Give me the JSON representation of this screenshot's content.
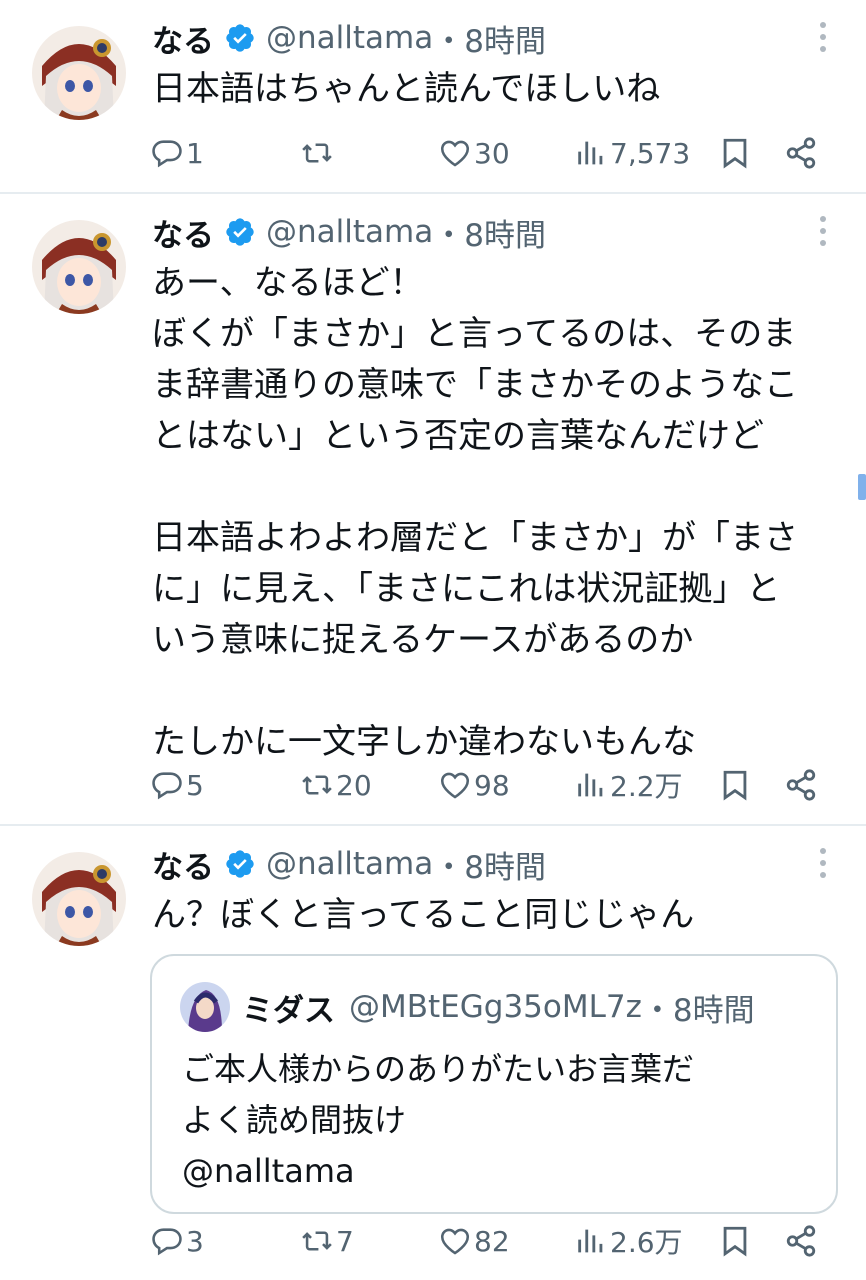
{
  "tweets": [
    {
      "name": "なる",
      "handle": "@nalltama",
      "time": "・8時間",
      "text": "日本語はちゃんと読んでほしいね",
      "replies": "1",
      "retweets": "",
      "likes": "30",
      "views": "7,573"
    },
    {
      "name": "なる",
      "handle": "@nalltama",
      "time": "・8時間",
      "text": "あー、なるほど！\nぼくが「まさか」と言ってるのは、そのま\nま辞書通りの意味で「まさかそのようなこ\nとはない」という否定の言葉なんだけど\n\n日本語よわよわ層だと「まさか」が「まさ\nに」に見え、「まさにこれは状況証拠」と\nいう意味に捉えるケースがあるのか\n\nたしかに一文字しか違わないもんな",
      "replies": "5",
      "retweets": "20",
      "likes": "98",
      "views": "2.2万"
    },
    {
      "name": "なる",
      "handle": "@nalltama",
      "time": "・8時間",
      "text": "ん？ぼくと言ってること同じじゃん",
      "replies": "3",
      "retweets": "7",
      "likes": "82",
      "views": "2.6万",
      "quote": {
        "name": "ミダス",
        "handle": "@MBtEGg35oML7z",
        "time": "・8時間",
        "text": "ご本人様からのありがたいお言葉だ\nよく読め間抜け",
        "mention": "@nalltama"
      }
    }
  ],
  "colors": {
    "verified": "#1d9bf0",
    "muted": "#536471",
    "border": "#e6ecf0"
  }
}
